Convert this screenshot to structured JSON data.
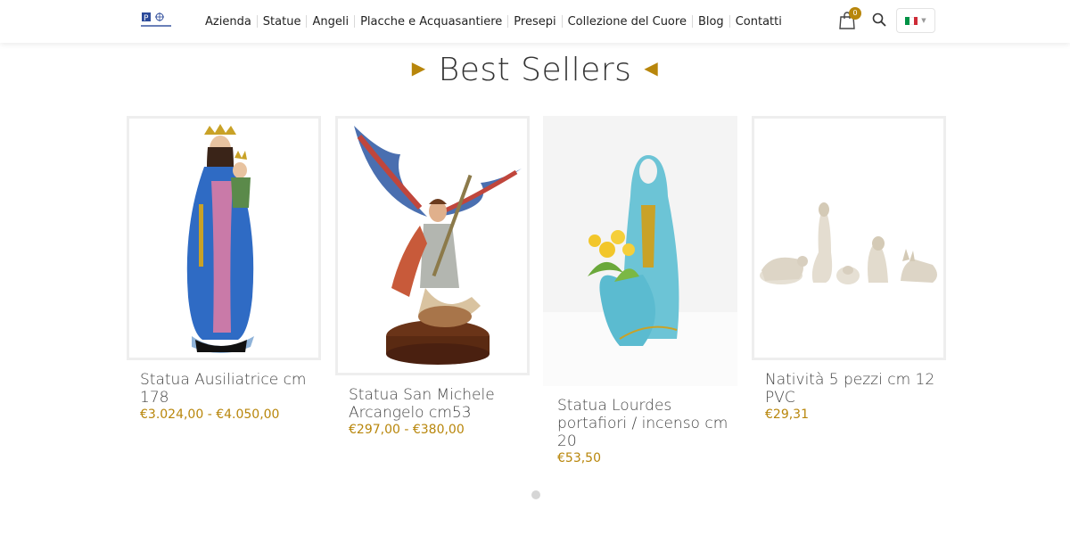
{
  "nav": {
    "items": [
      "Azienda",
      "Statue",
      "Angeli",
      "Placche e Acquasantiere",
      "Presepi",
      "Collezione del Cuore",
      "Blog",
      "Contatti"
    ]
  },
  "header": {
    "cart_count": "0",
    "icons": {
      "logo": "brand-logo",
      "cart": "shopping-bag-icon",
      "search": "search-icon",
      "language": "italian-flag-icon"
    },
    "flag_colors": [
      "#009246",
      "#ffffff",
      "#ce2b37"
    ]
  },
  "section": {
    "title": "Best Sellers"
  },
  "products": [
    {
      "name": "Statua Ausiliatrice cm 178",
      "price": "€3.024,00 - €4.050,00"
    },
    {
      "name": "Statua San Michele Arcangelo cm53",
      "price": "€297,00 - €380,00"
    },
    {
      "name": "Statua Lourdes portafiori / incenso cm 20",
      "price": "€53,50"
    },
    {
      "name": "Natività 5 pezzi cm 12 PVC",
      "price": "€29,31"
    }
  ],
  "colors": {
    "accent": "#b8860b",
    "text": "#333333",
    "border": "#eeeeee"
  }
}
